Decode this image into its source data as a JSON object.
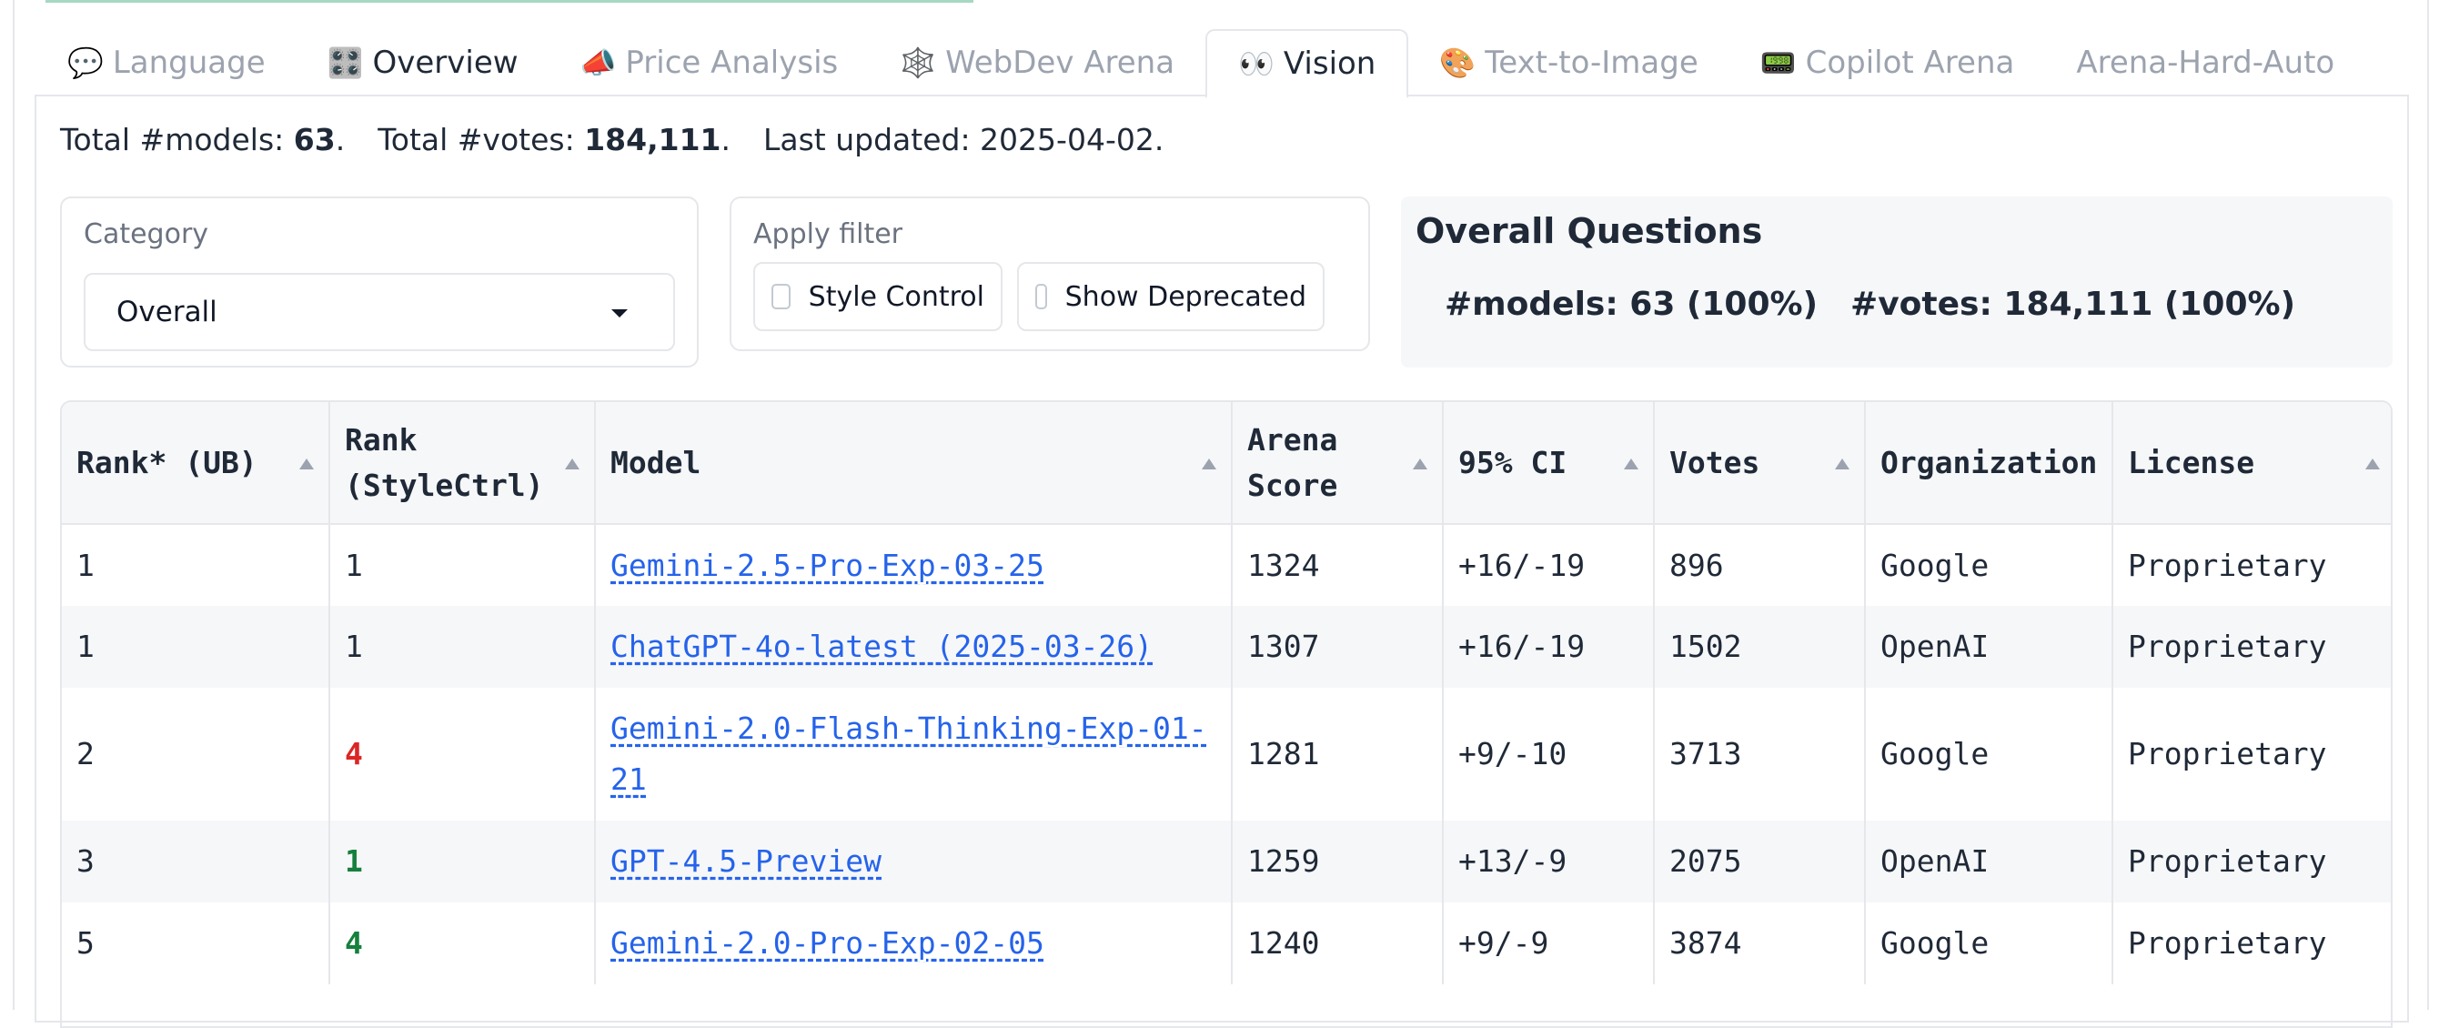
{
  "tabs": [
    {
      "icon": "💬",
      "label": "Language",
      "icon_name": "speech-bubble-icon",
      "state": "inactive"
    },
    {
      "icon": "🎛️",
      "label": "Overview",
      "icon_name": "control-knobs-icon",
      "state": "dark"
    },
    {
      "icon": "📣",
      "label": "Price Analysis",
      "icon_name": "megaphone-icon",
      "state": "inactive"
    },
    {
      "icon": "🕸️",
      "label": "WebDev Arena",
      "icon_name": "spider-web-icon",
      "state": "inactive"
    },
    {
      "icon": "👀",
      "label": "Vision",
      "icon_name": "eyes-icon",
      "state": "active"
    },
    {
      "icon": "🎨",
      "label": "Text-to-Image",
      "icon_name": "palette-icon",
      "state": "inactive"
    },
    {
      "icon": "📟",
      "label": "Copilot Arena",
      "icon_name": "pager-icon",
      "state": "inactive"
    },
    {
      "icon": "",
      "label": "Arena-Hard-Auto",
      "icon_name": "",
      "state": "inactive"
    }
  ],
  "summary": {
    "models_label": "Total #models: ",
    "models_value": "63",
    "votes_label": "Total #votes: ",
    "votes_value": "184,111",
    "updated_label": "Last updated: 2025-04-02."
  },
  "category": {
    "label": "Category",
    "selected": "Overall"
  },
  "filter": {
    "label": "Apply filter",
    "style_control": "Style Control",
    "show_deprecated": "Show Deprecated"
  },
  "overall": {
    "title": "Overall Questions",
    "models": "#models: 63 (100%)",
    "votes": "#votes: 184,111 (100%)"
  },
  "table": {
    "headers": [
      "Rank* (UB)",
      "Rank (StyleCtrl)",
      "Model",
      "Arena Score",
      "95% CI",
      "Votes",
      "Organization",
      "License"
    ],
    "rows": [
      {
        "rank": "1",
        "rank_sc": "1",
        "rank_sc_color": "default",
        "model": "Gemini-2.5-Pro-Exp-03-25",
        "score": "1324",
        "ci": "+16/-19",
        "votes": "896",
        "org": "Google",
        "license": "Proprietary"
      },
      {
        "rank": "1",
        "rank_sc": "1",
        "rank_sc_color": "default",
        "model": "ChatGPT-4o-latest (2025-03-26)",
        "score": "1307",
        "ci": "+16/-19",
        "votes": "1502",
        "org": "OpenAI",
        "license": "Proprietary"
      },
      {
        "rank": "2",
        "rank_sc": "4",
        "rank_sc_color": "red",
        "model": "Gemini-2.0-Flash-Thinking-Exp-01-21",
        "score": "1281",
        "ci": "+9/-10",
        "votes": "3713",
        "org": "Google",
        "license": "Proprietary"
      },
      {
        "rank": "3",
        "rank_sc": "1",
        "rank_sc_color": "green",
        "model": "GPT-4.5-Preview",
        "score": "1259",
        "ci": "+13/-9",
        "votes": "2075",
        "org": "OpenAI",
        "license": "Proprietary"
      },
      {
        "rank": "5",
        "rank_sc": "4",
        "rank_sc_color": "green",
        "model": "Gemini-2.0-Pro-Exp-02-05",
        "score": "1240",
        "ci": "+9/-9",
        "votes": "3874",
        "org": "Google",
        "license": "Proprietary"
      }
    ]
  }
}
